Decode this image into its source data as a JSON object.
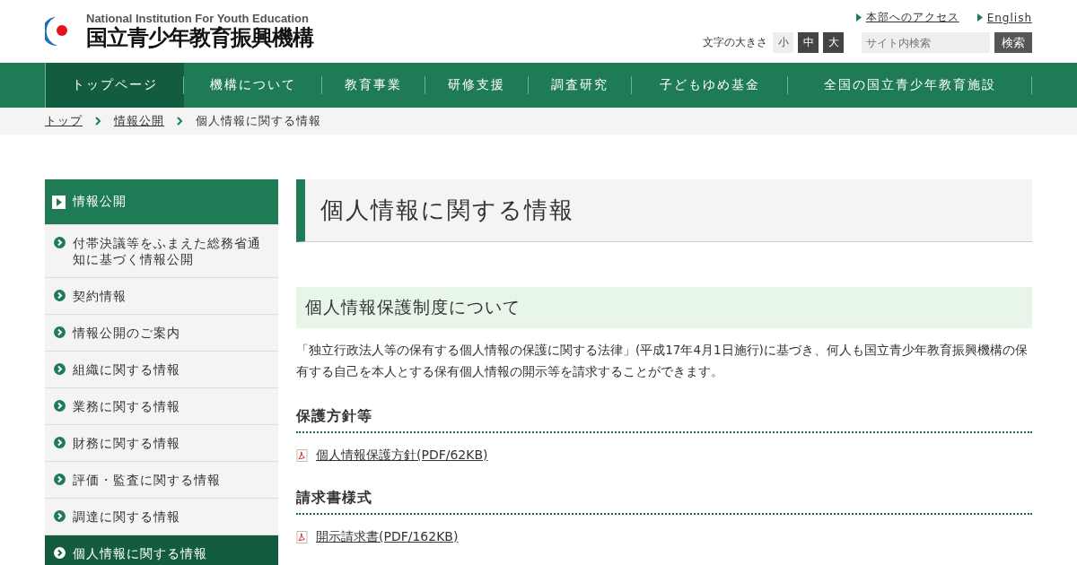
{
  "header": {
    "logo_subtitle": "National Institution For Youth Education",
    "logo_title": "国立青少年教育振興機構",
    "links": [
      "本部へのアクセス",
      "English"
    ],
    "font_size": {
      "label": "文字の大きさ",
      "options": [
        {
          "label": "小",
          "selected": true
        },
        {
          "label": "中",
          "selected": false
        },
        {
          "label": "大",
          "selected": false
        }
      ]
    },
    "search": {
      "placeholder": "サイト内検索",
      "button": "検索"
    }
  },
  "nav": [
    {
      "label": "トップページ",
      "selected": true
    },
    {
      "label": "機構について",
      "selected": false
    },
    {
      "label": "教育事業",
      "selected": false
    },
    {
      "label": "研修支援",
      "selected": false
    },
    {
      "label": "調査研究",
      "selected": false
    },
    {
      "label": "子どもゆめ基金",
      "selected": false
    },
    {
      "label": "全国の国立青少年教育施設",
      "selected": false
    }
  ],
  "breadcrumb": [
    "トップ",
    "情報公開",
    "個人情報に関する情報"
  ],
  "sidebar": {
    "title": "情報公開",
    "items": [
      {
        "label": "付帯決議等をふまえた総務省通知に基づく情報公開",
        "selected": false
      },
      {
        "label": "契約情報",
        "selected": false
      },
      {
        "label": "情報公開のご案内",
        "selected": false
      },
      {
        "label": "組織に関する情報",
        "selected": false
      },
      {
        "label": "業務に関する情報",
        "selected": false
      },
      {
        "label": "財務に関する情報",
        "selected": false
      },
      {
        "label": "評価・監査に関する情報",
        "selected": false
      },
      {
        "label": "調達に関する情報",
        "selected": false
      },
      {
        "label": "個人情報に関する情報",
        "selected": true
      }
    ]
  },
  "main": {
    "title": "個人情報に関する情報",
    "section_title": "個人情報保護制度について",
    "paragraph": "「独立行政法人等の保有する個人情報の保護に関する法律」(平成17年4月1日施行)に基づき、何人も国立青少年教育振興機構の保有する自己を本人とする保有個人情報の開示等を請求することができます。",
    "subsections": [
      {
        "heading": "保護方針等",
        "links": [
          "個人情報保護方針(PDF/62KB)"
        ]
      },
      {
        "heading": "請求書様式",
        "links": [
          "開示請求書(PDF/162KB)"
        ]
      }
    ]
  }
}
